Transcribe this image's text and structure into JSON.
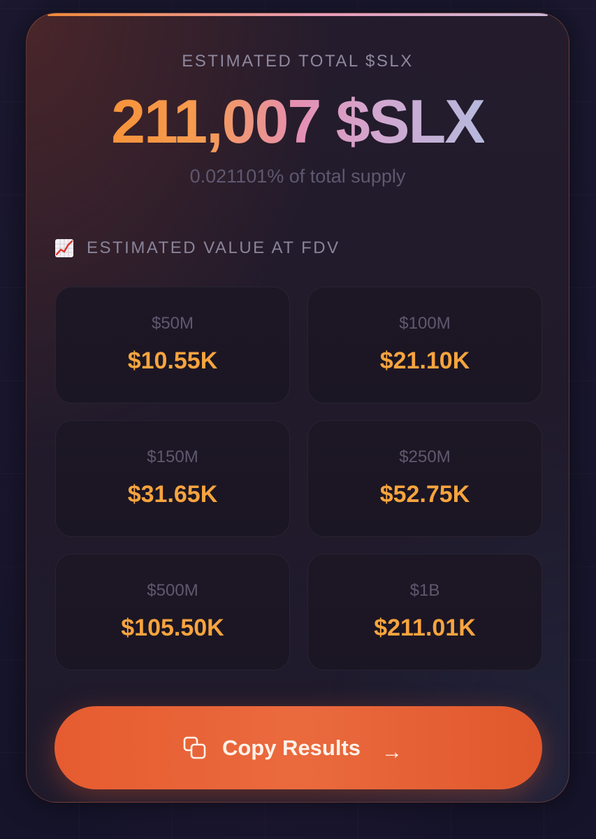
{
  "summary": {
    "label": "ESTIMATED TOTAL $SLX",
    "total": "211,007 $SLX",
    "supply_share": "0.021101% of total supply"
  },
  "fdv_section": {
    "icon": "chart-increasing-icon",
    "title": "ESTIMATED VALUE AT FDV",
    "tiles": [
      {
        "fdv": "$50M",
        "value": "$10.55K"
      },
      {
        "fdv": "$100M",
        "value": "$21.10K"
      },
      {
        "fdv": "$150M",
        "value": "$31.65K"
      },
      {
        "fdv": "$250M",
        "value": "$52.75K"
      },
      {
        "fdv": "$500M",
        "value": "$105.50K"
      },
      {
        "fdv": "$1B",
        "value": "$211.01K"
      }
    ]
  },
  "copy_button": {
    "icon": "copy-icon",
    "label": "Copy Results",
    "arrow": "→"
  },
  "colors": {
    "accent_orange": "#f7a43e",
    "button": "#e65c30",
    "background": "#16142a"
  }
}
